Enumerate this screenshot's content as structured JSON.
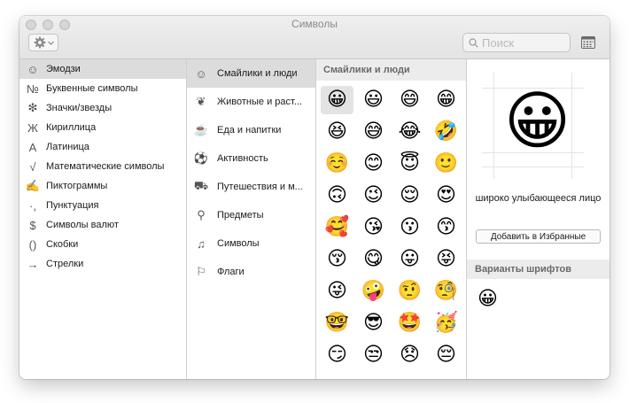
{
  "window": {
    "title": "Символы"
  },
  "toolbar": {
    "gear_icon": "gear-icon",
    "search": {
      "placeholder": "Поиск",
      "value": ""
    },
    "grid_icon": "character-viewer-icon"
  },
  "categories": [
    {
      "icon": "☺",
      "label": "Эмодзи"
    },
    {
      "icon": "№",
      "label": "Буквенные символы"
    },
    {
      "icon": "❇",
      "label": "Значки/звезды"
    },
    {
      "icon": "Ж",
      "label": "Кириллица"
    },
    {
      "icon": "A",
      "label": "Латиница"
    },
    {
      "icon": "√",
      "label": "Математические символы"
    },
    {
      "icon": "✍",
      "label": "Пиктограммы"
    },
    {
      "icon": "·,",
      "label": "Пунктуация"
    },
    {
      "icon": "$",
      "label": "Символы валют"
    },
    {
      "icon": "()",
      "label": "Скобки"
    },
    {
      "icon": "→",
      "label": "Стрелки"
    }
  ],
  "subcategories": [
    {
      "icon": "☺",
      "label": "Смайлики и люди"
    },
    {
      "icon": "❦",
      "label": "Животные и раст..."
    },
    {
      "icon": "☕",
      "label": "Еда и напитки"
    },
    {
      "icon": "⚽",
      "label": "Активность"
    },
    {
      "icon": "⛟",
      "label": "Путешествия и м..."
    },
    {
      "icon": "⚲",
      "label": "Предметы"
    },
    {
      "icon": "♫",
      "label": "Символы"
    },
    {
      "icon": "⚐",
      "label": "Флаги"
    }
  ],
  "grid": {
    "header": "Смайлики и люди",
    "emojis": [
      "😀",
      "😃",
      "😄",
      "😁",
      "😆",
      "😅",
      "😂",
      "🤣",
      "☺️",
      "😊",
      "😇",
      "🙂",
      "🙃",
      "😉",
      "😌",
      "😍",
      "🥰",
      "😘",
      "😗",
      "😙",
      "😚",
      "😋",
      "😛",
      "😝",
      "😜",
      "🤪",
      "🤨",
      "🧐",
      "🤓",
      "😎",
      "🤩",
      "🥳",
      "😏",
      "😒",
      "😞",
      "😔"
    ]
  },
  "detail": {
    "emoji": "😀",
    "name": "широко улыбающееся лицо",
    "favorites_button": "Добавить в Избранные",
    "variants_header": "Варианты шрифтов",
    "variants": [
      "😀"
    ]
  }
}
